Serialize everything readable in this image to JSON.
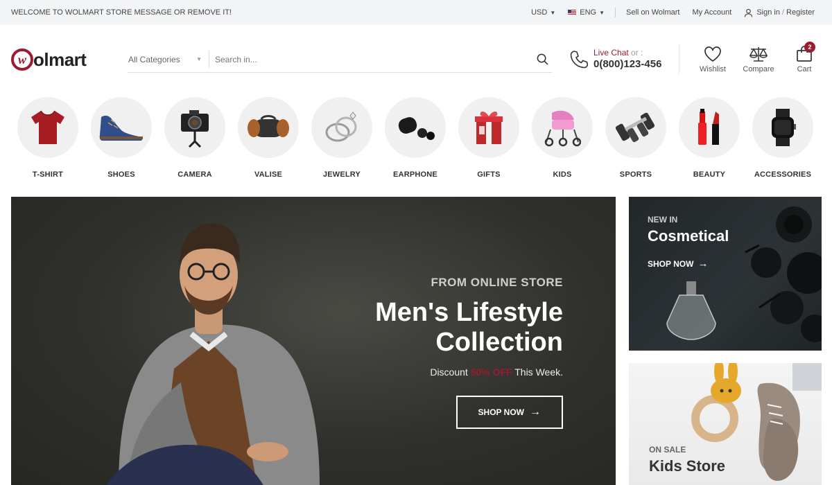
{
  "topbar": {
    "welcome": "WELCOME TO WOLMART STORE MESSAGE OR REMOVE IT!",
    "currency": "USD",
    "language": "ENG",
    "sell": "Sell on Wolmart",
    "account": "My Account",
    "signin": "Sign in",
    "slash": "/",
    "register": "Register"
  },
  "header": {
    "logo_mark": "w",
    "logo_text": "olmart",
    "category_select": "All Categories",
    "search_placeholder": "Search in...",
    "live_chat": "Live Chat",
    "or": "or :",
    "phone": "0(800)123-456",
    "wishlist": "Wishlist",
    "compare": "Compare",
    "cart": "Cart",
    "cart_count": "2"
  },
  "categories": [
    {
      "label": "T-SHIRT"
    },
    {
      "label": "SHOES"
    },
    {
      "label": "CAMERA"
    },
    {
      "label": "VALISE"
    },
    {
      "label": "JEWELRY"
    },
    {
      "label": "EARPHONE"
    },
    {
      "label": "GIFTS"
    },
    {
      "label": "KIDS"
    },
    {
      "label": "SPORTS"
    },
    {
      "label": "BEAUTY"
    },
    {
      "label": "ACCESSORIES"
    }
  ],
  "hero": {
    "subtitle": "FROM ONLINE STORE",
    "title_line1": "Men's Lifestyle",
    "title_line2": "Collection",
    "discount_pre": "Discount",
    "discount_off": "50% OFF",
    "discount_post": "This Week.",
    "button": "SHOP NOW"
  },
  "side_banner_1": {
    "tag": "NEW IN",
    "title": "Cosmetical",
    "button": "SHOP NOW"
  },
  "side_banner_2": {
    "tag": "ON SALE",
    "title": "Kids Store"
  },
  "colors": {
    "brand": "#9b1b30",
    "topbar_bg": "#f3f4f6"
  }
}
